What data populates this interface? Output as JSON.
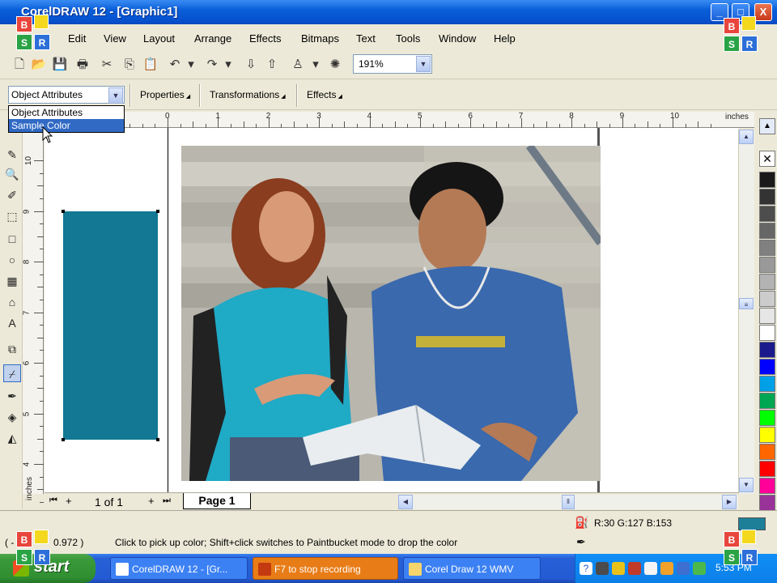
{
  "window": {
    "title": "CorelDRAW 12 - [Graphic1]",
    "min": "_",
    "max": "□",
    "close": "X"
  },
  "overlay": {
    "b": "B",
    "s": "S",
    "r": "R"
  },
  "menu": [
    "Edit",
    "View",
    "Layout",
    "Arrange",
    "Effects",
    "Bitmaps",
    "Text",
    "Tools",
    "Window",
    "Help"
  ],
  "toolbar": {
    "zoom": "191%"
  },
  "dockers": {
    "selected": "Object Attributes",
    "options": [
      "Object Attributes",
      "Sample Color"
    ],
    "tabs": [
      "Properties",
      "Transformations",
      "Effects"
    ]
  },
  "ruler": {
    "units": "inches",
    "h_labels": [
      "0",
      "1",
      "2",
      "3",
      "4",
      "5",
      "6",
      "7",
      "8",
      "9",
      "10"
    ],
    "v_labels": [
      "10",
      "9",
      "8",
      "7",
      "6",
      "5",
      "4"
    ],
    "v_units": "inches"
  },
  "page_nav": {
    "count": "1 of 1",
    "tab": "Page 1"
  },
  "status": {
    "coords": "( -",
    "coords_val": "0.972 )",
    "hint": "Click to pick up color; Shift+click switches to Paintbucket mode to drop the color",
    "color": "R:30 G:127 B:153",
    "swatch_color": "#1e7f99"
  },
  "taskbar": {
    "start": "start",
    "items": [
      "CorelDRAW 12 - [Gr...",
      "F7 to stop recording",
      "Corel Draw 12 WMV"
    ],
    "clock": "5:53 PM"
  },
  "palette": [
    "#ffffff",
    "#000000",
    "#1a1a1a",
    "#333333",
    "#4d4d4d",
    "#666666",
    "#808080",
    "#999999",
    "#b3b3b3",
    "#cccccc",
    "#e6e6e6",
    "#ffffff",
    "#1a1a8c",
    "#0000ff",
    "#00a0e8",
    "#00a651",
    "#00ff00",
    "#ffff00",
    "#ff6600",
    "#ff0000",
    "#ff0099",
    "#993399"
  ],
  "fill_color": "#127893"
}
